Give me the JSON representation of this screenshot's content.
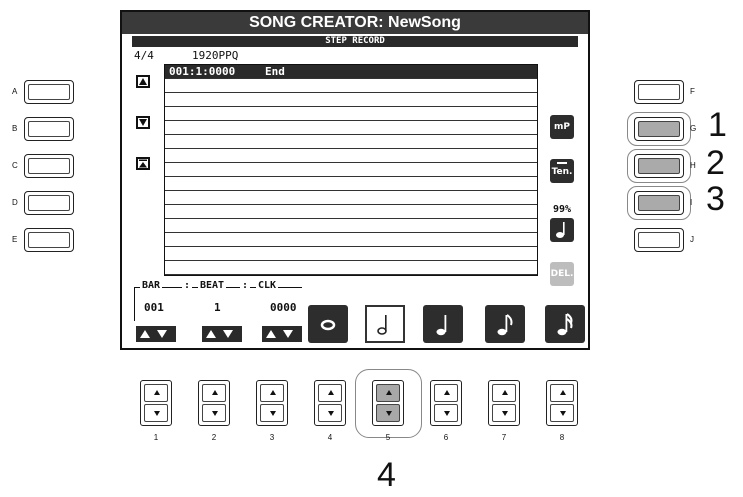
{
  "screen": {
    "title": "SONG CREATOR: NewSong",
    "subtitle": "STEP RECORD",
    "time_signature": "4/4",
    "resolution": "1920PPQ",
    "events": [
      {
        "position": "001:1:0000",
        "event": "End"
      }
    ],
    "side_icons": {
      "g": "mP",
      "h": "Ten.",
      "h_value": "99%",
      "j": "DEL."
    },
    "bar_beat_clk": {
      "bar_label": "BAR",
      "beat_label": "BEAT",
      "clk_label": "CLK",
      "separator": ":",
      "bar": "001",
      "beat": "1",
      "clk": "0000"
    },
    "note_lengths": [
      "whole-note-icon",
      "half-note-icon",
      "quarter-note-icon",
      "eighth-note-icon",
      "sixteenth-note-icon"
    ],
    "selected_note": "half-note-icon"
  },
  "left_buttons": [
    "A",
    "B",
    "C",
    "D",
    "E"
  ],
  "right_buttons": [
    "F",
    "G",
    "H",
    "I",
    "J"
  ],
  "pressed_right_buttons": [
    "G",
    "H",
    "I"
  ],
  "bottom_buttons": [
    "1",
    "2",
    "3",
    "4",
    "5",
    "6",
    "7",
    "8"
  ],
  "pressed_bottom_button": "5",
  "callouts": [
    "1",
    "2",
    "3",
    "4"
  ]
}
